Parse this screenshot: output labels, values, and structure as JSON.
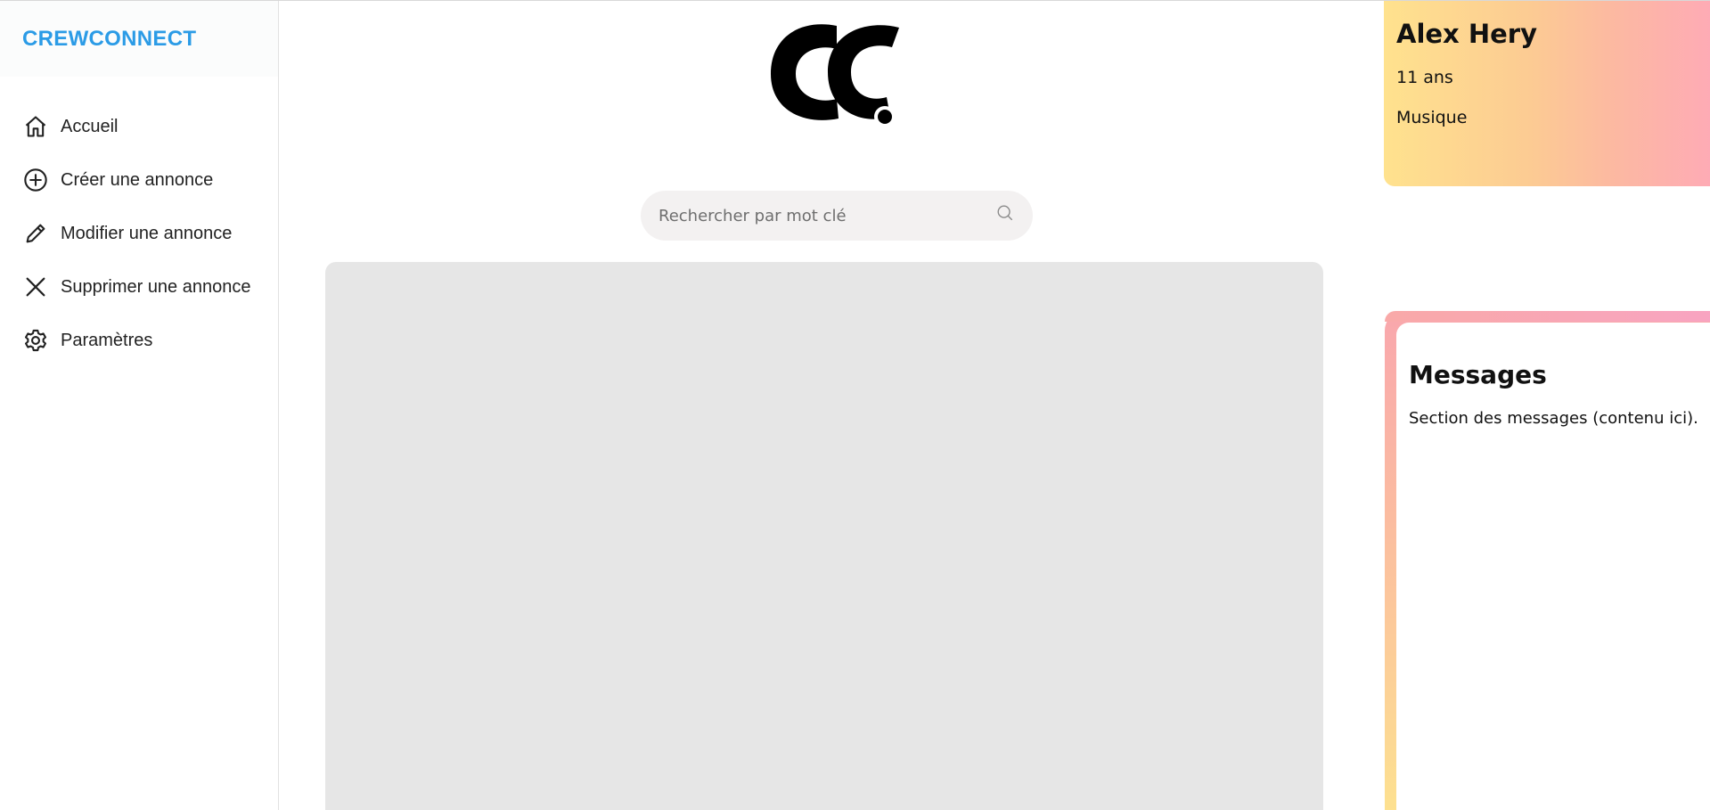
{
  "brand": {
    "name": "CREWCONNECT",
    "color": "#2b9be6"
  },
  "sidebar": {
    "items": [
      {
        "label": "Accueil",
        "icon": "home-icon"
      },
      {
        "label": "Créer une annonce",
        "icon": "plus-circle-icon"
      },
      {
        "label": "Modifier une annonce",
        "icon": "pencil-icon"
      },
      {
        "label": "Supprimer une annonce",
        "icon": "close-icon"
      },
      {
        "label": "Paramètres",
        "icon": "gear-icon"
      }
    ]
  },
  "header": {
    "logo": "cc-logo"
  },
  "search": {
    "placeholder": "Rechercher par mot clé",
    "icon": "search-icon"
  },
  "profile": {
    "name": "Alex Hery",
    "age": "11 ans",
    "interest": "Musique"
  },
  "messages": {
    "title": "Messages",
    "description": "Section des messages (contenu ici)."
  }
}
